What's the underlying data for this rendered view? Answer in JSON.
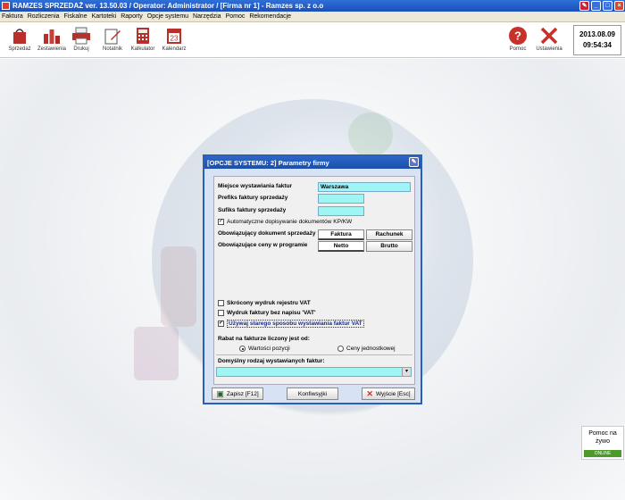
{
  "window": {
    "title": "RAMZES SPRZEDAŻ ver. 13.50.03 /   Operator: Administrator /   [Firma nr 1] - Ramzes sp. z o.o"
  },
  "menu": [
    "Faktura",
    "Rozliczenia",
    "Fiskalne",
    "Kartoteki",
    "Raporty",
    "Opcje systemu",
    "Narzędzia",
    "Pomoc",
    "Rekomendacje"
  ],
  "toolbar": {
    "left": [
      "Sprzedaż",
      "Zestawienia",
      "Drukuj",
      "Notatnik",
      "Kalkulator",
      "Kalendarz"
    ],
    "calendar_day": "23",
    "right": [
      "Pomoc",
      "Ustawienia"
    ]
  },
  "clock": {
    "date": "2013.08.09",
    "time": "09:54:34"
  },
  "dialog": {
    "title": "[OPCJE SYSTEMU: 2]  Parametry firmy",
    "place_label": "Miejsce wystawiania faktur",
    "place_value": "Warszawa",
    "prefix_label": "Prefiks faktury sprzedaży",
    "suffix_label": "Sufiks faktury sprzedaży",
    "auto_kpkw_label": "Automatyczne dopisywanie dokumentów KP/KW",
    "doc_label": "Obowiązujący dokument sprzedaży",
    "doc_options": [
      "Faktura",
      "Rachunek"
    ],
    "price_label": "Obowiązujące ceny w programie",
    "price_options": [
      "Netto",
      "Brutto"
    ],
    "short_vat_label": "Skrócony wydruk rejestru VAT",
    "no_vat_label": "Wydruk faktury bez napisu 'VAT'",
    "old_method_label": "Używaj starego sposobu wystawiania faktur VAT",
    "discount_label": "Rabat na fakturze liczony jest od:",
    "discount_options": [
      "Wartości pozycji",
      "Ceny jednostkowej"
    ],
    "default_kind_label": "Domyślny rodzaj wystawianych faktur:",
    "save_label": "Zapisz  [F12]",
    "config_label": "Konfiwsyjki",
    "exit_label": "Wyjście  [Esc]"
  },
  "help_widget": {
    "line1": "Pomoc na",
    "line2": "żywo",
    "status": "ONLINE"
  }
}
